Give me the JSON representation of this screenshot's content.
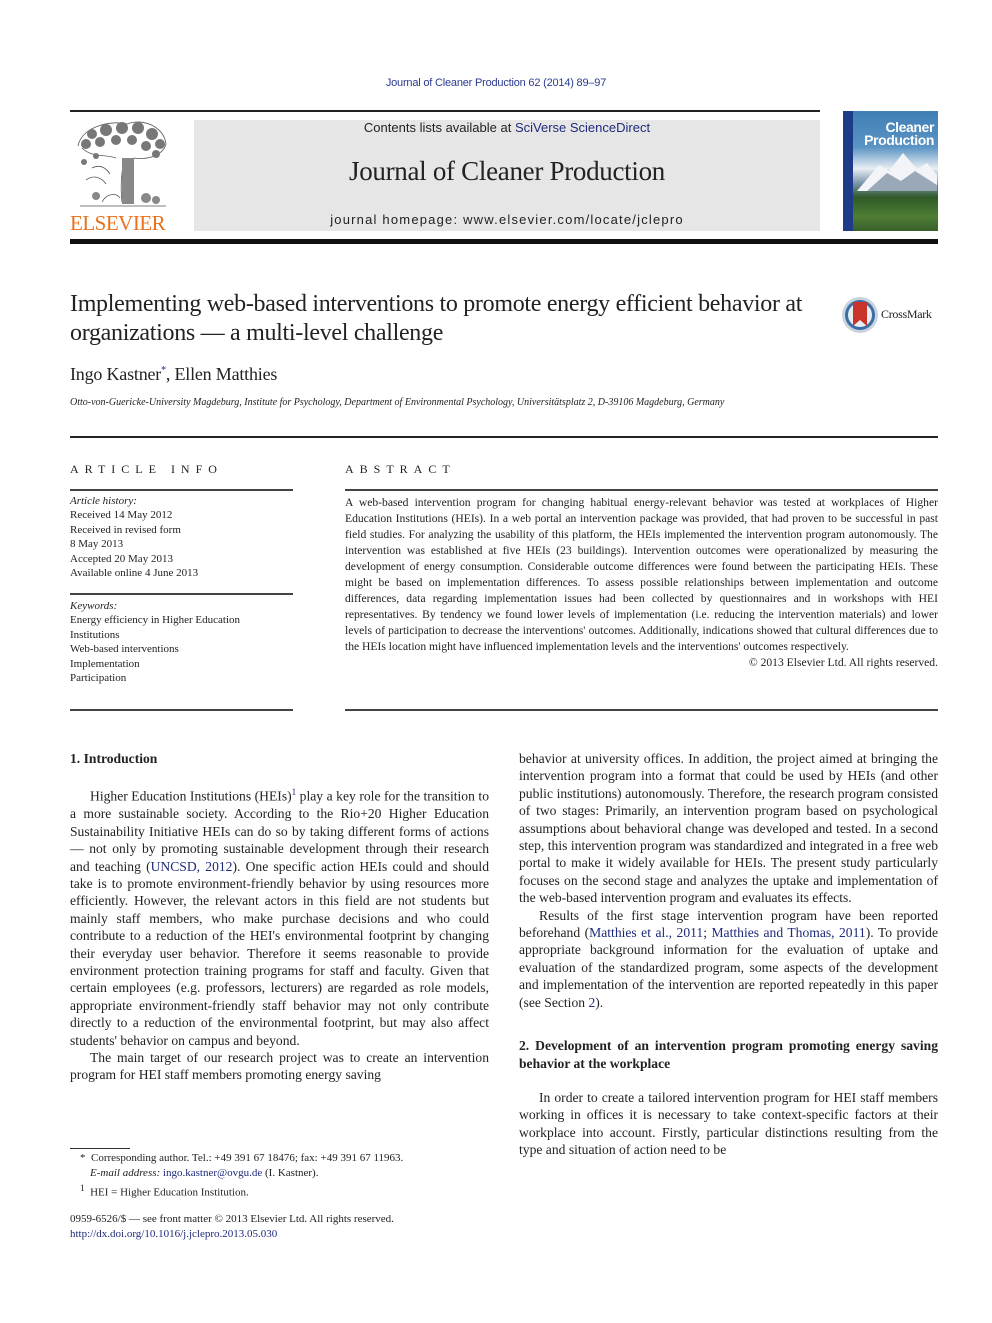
{
  "header": {
    "running_head": "Journal of Cleaner Production 62 (2014) 89–97",
    "publisher_logo_text": "ELSEVIER",
    "contents_prefix": "Contents lists available at ",
    "contents_link": "SciVerse ScienceDirect",
    "journal_title": "Journal of Cleaner Production",
    "homepage": "journal homepage: www.elsevier.com/locate/jclepro",
    "cover_title_line1": "Cleaner",
    "cover_title_line2": "Production",
    "colors": {
      "link": "#1f2a7a",
      "elsevier_orange": "#e9711c",
      "banner_gray": "#e6e6e6"
    }
  },
  "article": {
    "title": "Implementing web-based interventions to promote energy efficient behavior at organizations — a multi-level challenge",
    "crossmark_label": "CrossMark",
    "authors": [
      {
        "name": "Ingo Kastner",
        "mark": "*"
      },
      {
        "name": "Ellen Matthies",
        "mark": ""
      }
    ],
    "author_separator": ", ",
    "affiliation": "Otto-von-Guericke-University Magdeburg, Institute for Psychology, Department of Environmental Psychology, Universitätsplatz 2, D-39106 Magdeburg, Germany"
  },
  "article_info": {
    "heading": "ARTICLE INFO",
    "history_label": "Article history:",
    "history": [
      "Received 14 May 2012",
      "Received in revised form",
      "8 May 2013",
      "Accepted 20 May 2013",
      "Available online 4 June 2013"
    ],
    "keywords_label": "Keywords:",
    "keywords": [
      "Energy efficiency in Higher Education Institutions",
      "Web-based interventions",
      "Implementation",
      "Participation"
    ]
  },
  "abstract": {
    "heading": "ABSTRACT",
    "text": "A web-based intervention program for changing habitual energy-relevant behavior was tested at workplaces of Higher Education Institutions (HEIs). In a web portal an intervention package was provided, that had proven to be successful in past field studies. For analyzing the usability of this platform, the HEIs implemented the intervention program autonomously. The intervention was established at five HEIs (23 buildings). Intervention outcomes were operationalized by measuring the development of energy consumption. Considerable outcome differences were found between the participating HEIs. These might be based on implementation differences. To assess possible relationships between implementation and outcome differences, data regarding implementation issues had been collected by questionnaires and in workshops with HEI representatives. By tendency we found lower levels of implementation (i.e. reducing the intervention materials) and lower levels of participation to decrease the interventions' outcomes. Additionally, indications showed that cultural differences due to the HEIs location might have influenced implementation levels and the interventions' outcomes respectively.",
    "copyright": "© 2013 Elsevier Ltd. All rights reserved."
  },
  "body": {
    "section1_heading": "1.  Introduction",
    "p1_a": "Higher Education Institutions (HEIs)",
    "p1_fnmark": "1",
    "p1_b": " play a key role for the transition to a more sustainable society. According to the Rio+20 Higher Education Sustainability Initiative HEIs can do so by taking different forms of actions — not only by promoting sustainable development through their research and teaching (",
    "p1_cite": "UNCSD, 2012",
    "p1_c": "). One specific action HEIs could and should take is to promote environment-friendly behavior by using resources more efficiently. However, the relevant actors in this field are not students but mainly staff members, who make purchase decisions and who could contribute to a reduction of the HEI's environmental footprint by changing their everyday user behavior. Therefore it seems reasonable to provide environment protection training programs for staff and faculty. Given that certain employees (e.g. professors, lecturers) are regarded as role models, appropriate environment-friendly staff behavior may not only contribute directly to a reduction of the environmental footprint, but may also affect students' behavior on campus and beyond.",
    "p2_left": "The main target of our research project was to create an intervention program for HEI staff members promoting energy saving",
    "p2_right": "behavior at university offices. In addition, the project aimed at bringing the intervention program into a format that could be used by HEIs (and other public institutions) autonomously. Therefore, the research program consisted of two stages: Primarily, an intervention program based on psychological assumptions about behavioral change was developed and tested. In a second step, this intervention program was standardized and integrated in a free web portal to make it widely available for HEIs. The present study particularly focuses on the second stage and analyzes the uptake and implementation of the web-based intervention program and evaluates its effects.",
    "p3_a": "Results of the first stage intervention program have been reported beforehand (",
    "p3_cite1": "Matthies et al., 2011",
    "p3_sep": "; ",
    "p3_cite2": "Matthies and Thomas, 2011",
    "p3_b": "). To provide appropriate background information for the evaluation of uptake and evaluation of the standardized program, some aspects of the development and implementation of the intervention are reported repeatedly in this paper (see Section ",
    "p3_sec": "2",
    "p3_c": ").",
    "section2_heading": "2.  Development of an intervention program promoting energy saving behavior at the workplace",
    "p4": "In order to create a tailored intervention program for HEI staff members working in offices it is necessary to take context-specific factors at their workplace into account. Firstly, particular distinctions resulting from the type and situation of action need to be"
  },
  "footnotes": {
    "corr_mark": "*",
    "corr_text": "Corresponding author. Tel.: +49 391 67 18476; fax: +49 391 67 11963.",
    "email_label": "E-mail address: ",
    "email": "ingo.kastner@ovgu.de",
    "email_suffix": " (I. Kastner).",
    "fn1_mark": "1",
    "fn1_text": "HEI = Higher Education Institution."
  },
  "front_matter": {
    "issn_line": "0959-6526/$ — see front matter © 2013 Elsevier Ltd. All rights reserved.",
    "doi": "http://dx.doi.org/10.1016/j.jclepro.2013.05.030"
  }
}
